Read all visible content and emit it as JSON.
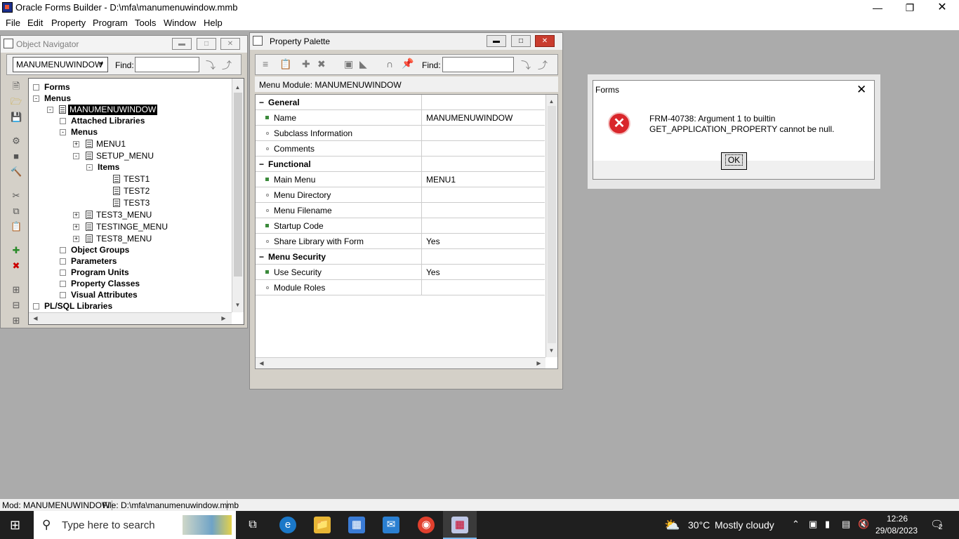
{
  "app": {
    "title": "Oracle Forms Builder - D:\\mfa\\manumenuwindow.mmb",
    "menu": [
      "File",
      "Edit",
      "Property",
      "Program",
      "Tools",
      "Window",
      "Help"
    ]
  },
  "navigator": {
    "title": "Object Navigator",
    "combo_value": "MANUMENUWINDOW",
    "find_label": "Find:",
    "tree": {
      "forms": "Forms",
      "menus": "Menus",
      "module": "MANUMENUWINDOW",
      "attached_libraries": "Attached Libraries",
      "menus_sub": "Menus",
      "menu1": "MENU1",
      "setup_menu": "SETUP_MENU",
      "items": "Items",
      "test1": "TEST1",
      "test2": "TEST2",
      "test3": "TEST3",
      "test3_menu": "TEST3_MENU",
      "testinge_menu": "TESTINGE_MENU",
      "test8_menu": "TEST8_MENU",
      "object_groups": "Object Groups",
      "parameters": "Parameters",
      "program_units": "Program Units",
      "property_classes": "Property Classes",
      "visual_attributes": "Visual Attributes",
      "plsql_libraries": "PL/SQL Libraries"
    }
  },
  "palette": {
    "title": "Property Palette",
    "find_label": "Find:",
    "header": "Menu Module: MANUMENUWINDOW",
    "sections": {
      "general": "General",
      "functional": "Functional",
      "security": "Menu Security"
    },
    "props": {
      "name": {
        "label": "Name",
        "value": "MANUMENUWINDOW"
      },
      "subclass": {
        "label": "Subclass Information",
        "value": ""
      },
      "comments": {
        "label": "Comments",
        "value": ""
      },
      "main_menu": {
        "label": "Main Menu",
        "value": "MENU1"
      },
      "menu_directory": {
        "label": "Menu Directory",
        "value": ""
      },
      "menu_filename": {
        "label": "Menu Filename",
        "value": ""
      },
      "startup_code": {
        "label": "Startup Code",
        "value": ""
      },
      "share_library": {
        "label": "Share Library with Form",
        "value": "Yes"
      },
      "use_security": {
        "label": "Use Security",
        "value": "Yes"
      },
      "module_roles": {
        "label": "Module Roles",
        "value": ""
      }
    }
  },
  "dialog": {
    "title": "Forms",
    "message_line1": "FRM-40738: Argument 1 to builtin",
    "message_line2": "GET_APPLICATION_PROPERTY cannot be null.",
    "ok_label": "OK"
  },
  "status": {
    "mod": "Mod: MANUMENUWINDOW",
    "file": "File: D:\\mfa\\manumenuwindow.mmb"
  },
  "taskbar": {
    "search_placeholder": "Type here to search",
    "weather_temp": "30°C",
    "weather_text": "Mostly cloudy",
    "time": "12:26",
    "date": "29/08/2023",
    "notification_count": "2"
  }
}
